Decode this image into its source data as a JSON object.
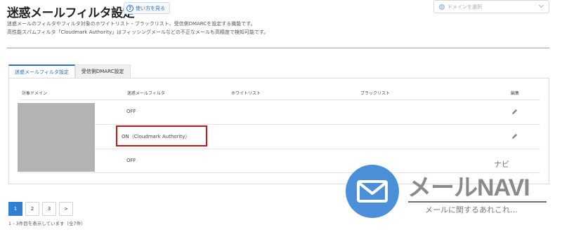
{
  "header": {
    "title": "迷惑メールフィルタ設定",
    "help_label": "使い方を見る",
    "help_glyph": "?",
    "domain_placeholder": "ドメインを選択"
  },
  "description": {
    "line1": "迷惑メールのフィルタやフィルタ対象のホワイトリスト・ブラックリスト、受信側DMARCを設定する機能です。",
    "line2": "高性能スパムフィルタ「Cloudmark Authority」はフィッシングメールなどの不正なメールも高精度で検知可能です。"
  },
  "tabs": [
    {
      "label": "迷惑メールフィルタ設定",
      "active": true
    },
    {
      "label": "受信側DMARC設定",
      "active": false
    }
  ],
  "table": {
    "columns": [
      "対象ドメイン",
      "迷惑メールフィルタ",
      "ホワイトリスト",
      "ブラックリスト",
      "編集"
    ],
    "rows": [
      {
        "filter": "OFF"
      },
      {
        "filter": "ON（Cloudmark Authority）"
      },
      {
        "filter": "OFF"
      }
    ]
  },
  "pagination": {
    "pages": [
      "1",
      "2",
      "3",
      ">"
    ],
    "active": "1",
    "count_text": "1 - 3件目を表示しています（全7件）"
  },
  "watermark": {
    "brand": "メールNAVI",
    "ruby": "ナビ",
    "tagline": "メールに関するあれこれ…"
  },
  "colors": {
    "accent": "#2f80d0",
    "highlight": "#cc1616",
    "logo": "#4b8fd8"
  }
}
